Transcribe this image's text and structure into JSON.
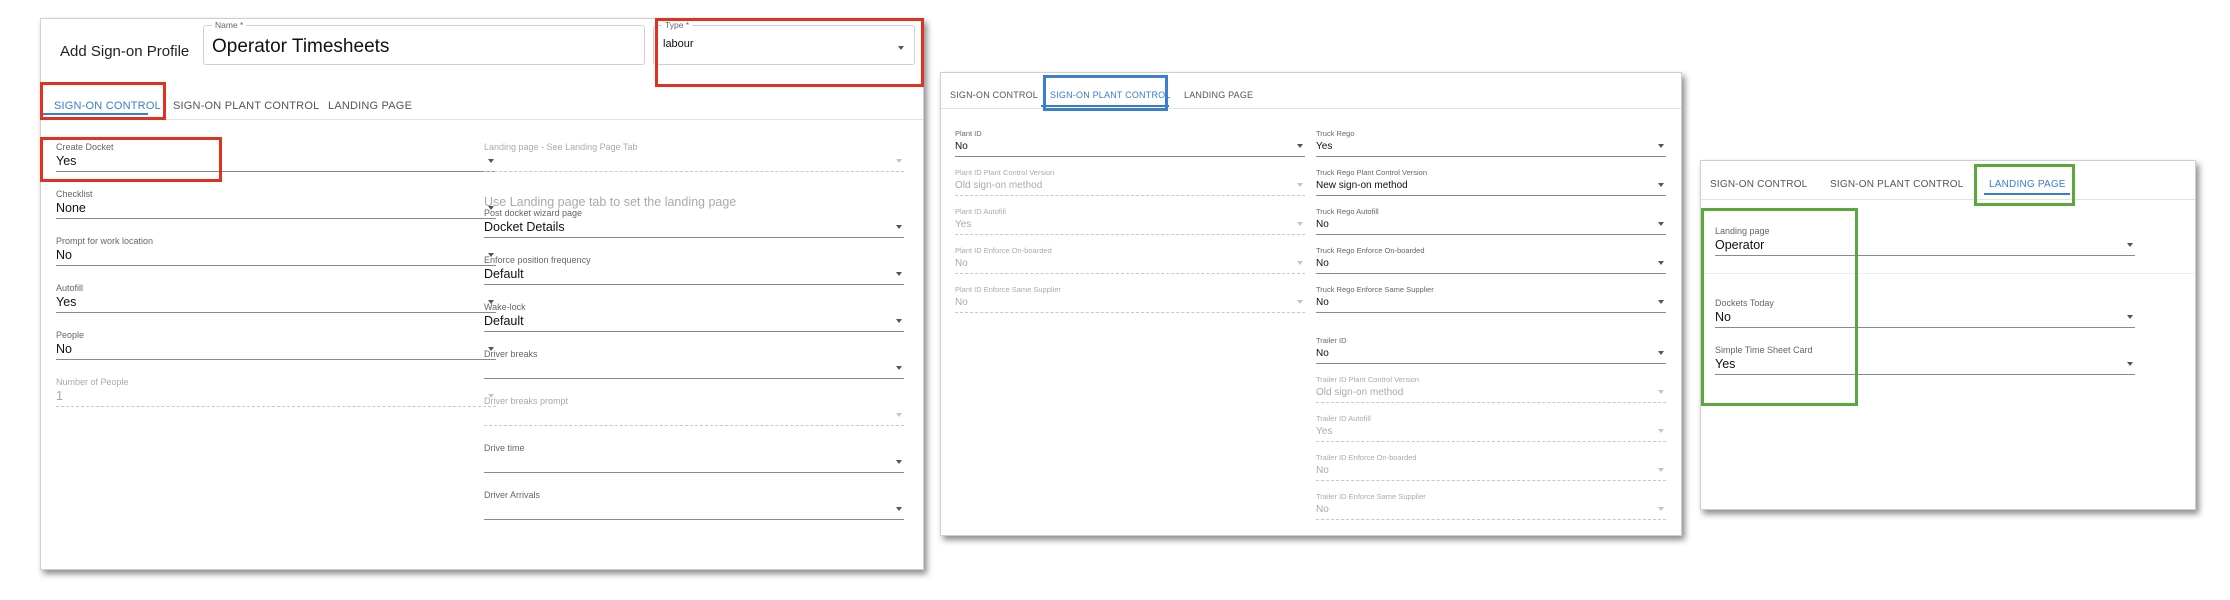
{
  "panel1": {
    "title": "Add Sign-on Profile",
    "name_field": {
      "label": "Name *",
      "value": "Operator Timesheets"
    },
    "type_field": {
      "label": "Type *",
      "value": "labour"
    },
    "tabs": [
      "SIGN-ON CONTROL",
      "SIGN-ON PLANT CONTROL",
      "LANDING PAGE"
    ],
    "left_fields": [
      {
        "label": "Create Docket",
        "value": "Yes"
      },
      {
        "label": "Checklist",
        "value": "None"
      },
      {
        "label": "Prompt for work location",
        "value": "No"
      },
      {
        "label": "Autofill",
        "value": "Yes"
      },
      {
        "label": "People",
        "value": "No"
      },
      {
        "label": "Number of People",
        "value": "1"
      }
    ],
    "right_fields": [
      {
        "label": "Landing page - See Landing Page Tab",
        "value": ""
      },
      {
        "label": "",
        "value": "Use Landing page tab to set the landing page"
      },
      {
        "label": "Post docket wizard page",
        "value": "Docket Details"
      },
      {
        "label": "Enforce position frequency",
        "value": "Default"
      },
      {
        "label": "Wake-lock",
        "value": "Default"
      },
      {
        "label": "Driver breaks",
        "value": ""
      },
      {
        "label": "Driver breaks prompt",
        "value": ""
      },
      {
        "label": "Drive time",
        "value": ""
      },
      {
        "label": "Driver Arrivals",
        "value": ""
      }
    ]
  },
  "panel2": {
    "tabs": [
      "SIGN-ON CONTROL",
      "SIGN-ON PLANT CONTROL",
      "LANDING PAGE"
    ],
    "left_fields": [
      {
        "label": "Plant ID",
        "value": "No"
      },
      {
        "label": "Plant ID Plant Control Version",
        "value": "Old sign-on method"
      },
      {
        "label": "Plant ID Autofill",
        "value": "Yes"
      },
      {
        "label": "Plant ID Enforce On-boarded",
        "value": "No"
      },
      {
        "label": "Plant ID Enforce Same Supplier",
        "value": "No"
      }
    ],
    "right_fields": [
      {
        "label": "Truck Rego",
        "value": "Yes"
      },
      {
        "label": "Truck Rego Plant Control Version",
        "value": "New sign-on method"
      },
      {
        "label": "Truck Rego Autofill",
        "value": "No"
      },
      {
        "label": "Truck Rego Enforce On-boarded",
        "value": "No"
      },
      {
        "label": "Truck Rego Enforce Same Supplier",
        "value": "No"
      },
      {
        "label": "Trailer ID",
        "value": "No"
      },
      {
        "label": "Trailer ID Plant Control Version",
        "value": "Old sign-on method"
      },
      {
        "label": "Trailer ID Autofill",
        "value": "Yes"
      },
      {
        "label": "Trailer ID Enforce On-boarded",
        "value": "No"
      },
      {
        "label": "Trailer ID Enforce Same Supplier",
        "value": "No"
      }
    ]
  },
  "panel3": {
    "tabs": [
      "SIGN-ON CONTROL",
      "SIGN-ON PLANT CONTROL",
      "LANDING PAGE"
    ],
    "fields": [
      {
        "label": "Landing page",
        "value": "Operator"
      },
      {
        "label": "Dockets Today",
        "value": "No"
      },
      {
        "label": "Simple Time Sheet Card",
        "value": "Yes"
      }
    ]
  },
  "colors": {
    "accent": "#3a7bd5",
    "highlight_red": "#e0321f",
    "highlight_blue": "#3c7fd0",
    "highlight_green": "#5aa83c"
  }
}
